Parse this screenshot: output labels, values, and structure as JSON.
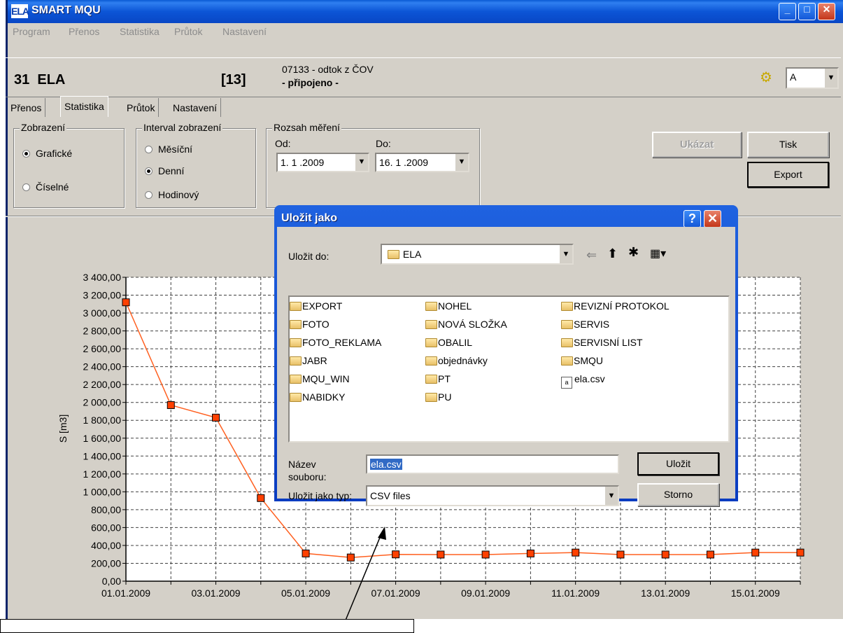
{
  "app": {
    "title": "SMART MQU",
    "logo": "ELA-logo-icon"
  },
  "window_controls": {
    "minimize": "_",
    "maximize": "□",
    "close": "✕"
  },
  "menu": [
    "Program",
    "Přenos",
    "Statistika",
    "Průtok",
    "Nastavení"
  ],
  "device": {
    "name": "31  ELA",
    "count": "[13]",
    "description": "07133 - odtok z ČOV",
    "status": "- připojeno -",
    "channel": "A"
  },
  "tabs": [
    "Přenos",
    "Statistika",
    "Průtok",
    "Nastavení"
  ],
  "display": {
    "title": "Zobrazení",
    "graphic": "Grafické",
    "numeric": "Číselné"
  },
  "interval": {
    "title": "Interval zobrazení",
    "monthly": "Měsíční",
    "daily": "Denní",
    "hourly": "Hodinový"
  },
  "range": {
    "title": "Rozsah měření",
    "from_label": "Od:",
    "to_label": "Do:",
    "from": "1. 1 .2009",
    "to": "16. 1 .2009"
  },
  "buttons": {
    "show": "Ukázat",
    "print": "Tisk",
    "export": "Export"
  },
  "dialog": {
    "title": "Uložit jako",
    "save_in_label": "Uložit do:",
    "folder": "ELA",
    "files": [
      {
        "name": "EXPORT",
        "type": "folder"
      },
      {
        "name": "FOTO",
        "type": "folder"
      },
      {
        "name": "FOTO_REKLAMA",
        "type": "folder"
      },
      {
        "name": "JABR",
        "type": "folder"
      },
      {
        "name": "MQU_WIN",
        "type": "folder"
      },
      {
        "name": "NABIDKY",
        "type": "folder"
      },
      {
        "name": "NOHEL",
        "type": "folder"
      },
      {
        "name": "NOVÁ SLOŽKA",
        "type": "folder"
      },
      {
        "name": "OBALIL",
        "type": "folder"
      },
      {
        "name": "objednávky",
        "type": "folder"
      },
      {
        "name": "PT",
        "type": "folder"
      },
      {
        "name": "PU",
        "type": "folder"
      },
      {
        "name": "REVIZNÍ PROTOKOL",
        "type": "folder"
      },
      {
        "name": "SERVIS",
        "type": "folder"
      },
      {
        "name": "SERVISNÍ LIST",
        "type": "folder"
      },
      {
        "name": "SMQU",
        "type": "folder"
      },
      {
        "name": "ela.csv",
        "type": "csv"
      }
    ],
    "filename_label_1": "Název",
    "filename_label_2": "souboru:",
    "filename": "ela.csv",
    "type_label": "Uložit jako typ:",
    "type_value": "CSV files",
    "save": "Uložit",
    "cancel": "Storno",
    "help": "?",
    "close": "✕"
  },
  "chart_data": {
    "type": "line",
    "ylabel": "S [m3]",
    "xlabel": "",
    "x": [
      "01.01.2009",
      "02.01.2009",
      "03.01.2009",
      "04.01.2009",
      "05.01.2009",
      "06.01.2009",
      "07.01.2009",
      "08.01.2009",
      "09.01.2009",
      "10.01.2009",
      "11.01.2009",
      "12.01.2009",
      "13.01.2009",
      "14.01.2009",
      "15.01.2009",
      "16.01.2009"
    ],
    "values": [
      3120,
      1970,
      1830,
      930,
      310,
      265,
      300,
      298,
      298,
      310,
      320,
      298,
      298,
      298,
      320,
      320
    ],
    "ylim": [
      0,
      3400
    ],
    "y_ticks": [
      "0,00",
      "200,00",
      "400,00",
      "600,00",
      "800,00",
      "1 000,00",
      "1 200,00",
      "1 400,00",
      "1 600,00",
      "1 800,00",
      "2 000,00",
      "2 200,00",
      "2 400,00",
      "2 600,00",
      "2 800,00",
      "3 000,00",
      "3 200,00",
      "3 400,00"
    ],
    "x_tick_labels": [
      "01.01.2009",
      "03.01.2009",
      "05.01.2009",
      "07.01.2009",
      "09.01.2009",
      "11.01.2009",
      "13.01.2009",
      "15.01.2009"
    ],
    "grid": true,
    "line_color": "#ff6020",
    "marker_color": "#ff4000"
  }
}
